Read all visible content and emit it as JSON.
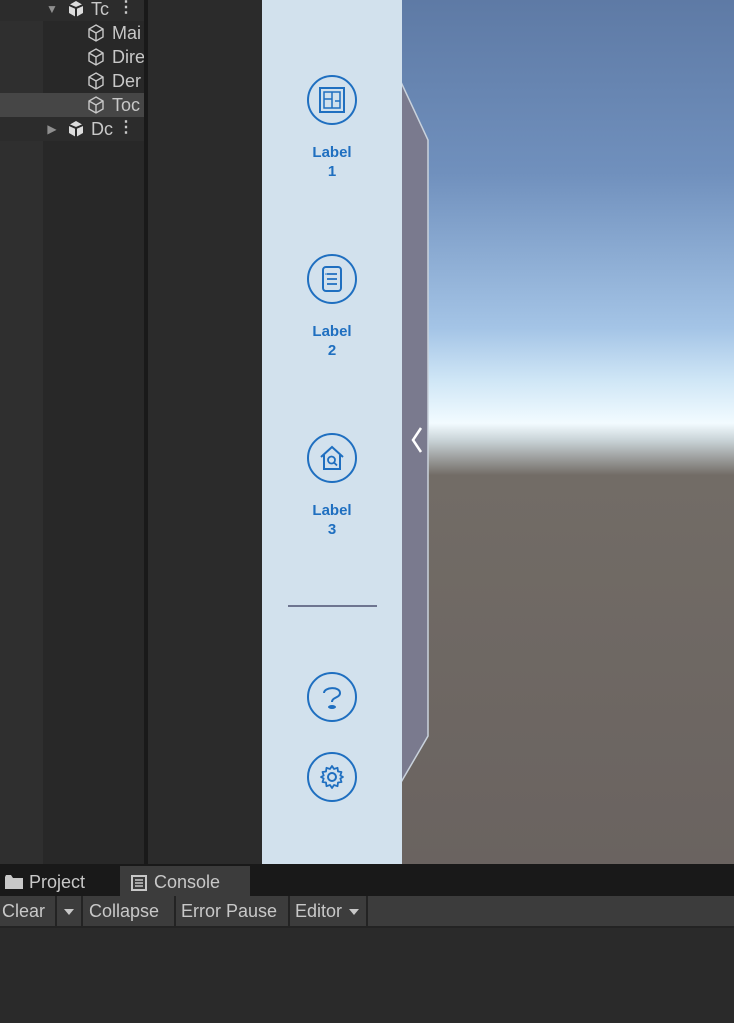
{
  "hierarchy": {
    "items": [
      {
        "label": "Tc",
        "expanded": true,
        "prefab": true
      },
      {
        "label": "Mai"
      },
      {
        "label": "Dire"
      },
      {
        "label": "Der"
      },
      {
        "label": "Toc",
        "selected": true
      },
      {
        "label": "Dc",
        "expanded": false,
        "prefab": true
      }
    ]
  },
  "side_panel": {
    "buttons": [
      {
        "label_line1": "Label",
        "label_line2": "1",
        "icon": "floorplan-icon"
      },
      {
        "label_line1": "Label",
        "label_line2": "2",
        "icon": "list-document-icon"
      },
      {
        "label_line1": "Label",
        "label_line2": "3",
        "icon": "house-search-icon"
      }
    ],
    "help_icon": "help-icon",
    "settings_icon": "settings-gear-icon",
    "collapse_icon": "chevron-left-icon",
    "accent_color": "#1f6fc0",
    "background_color": "#d2e1ed"
  },
  "bottom": {
    "tabs": [
      {
        "label": "Project",
        "icon": "folder-icon"
      },
      {
        "label": "Console",
        "icon": "console-icon",
        "active": true
      }
    ],
    "toolbar": {
      "clear_label": "Clear",
      "collapse_label": "Collapse",
      "error_pause_label": "Error Pause",
      "editor_label": "Editor"
    }
  }
}
